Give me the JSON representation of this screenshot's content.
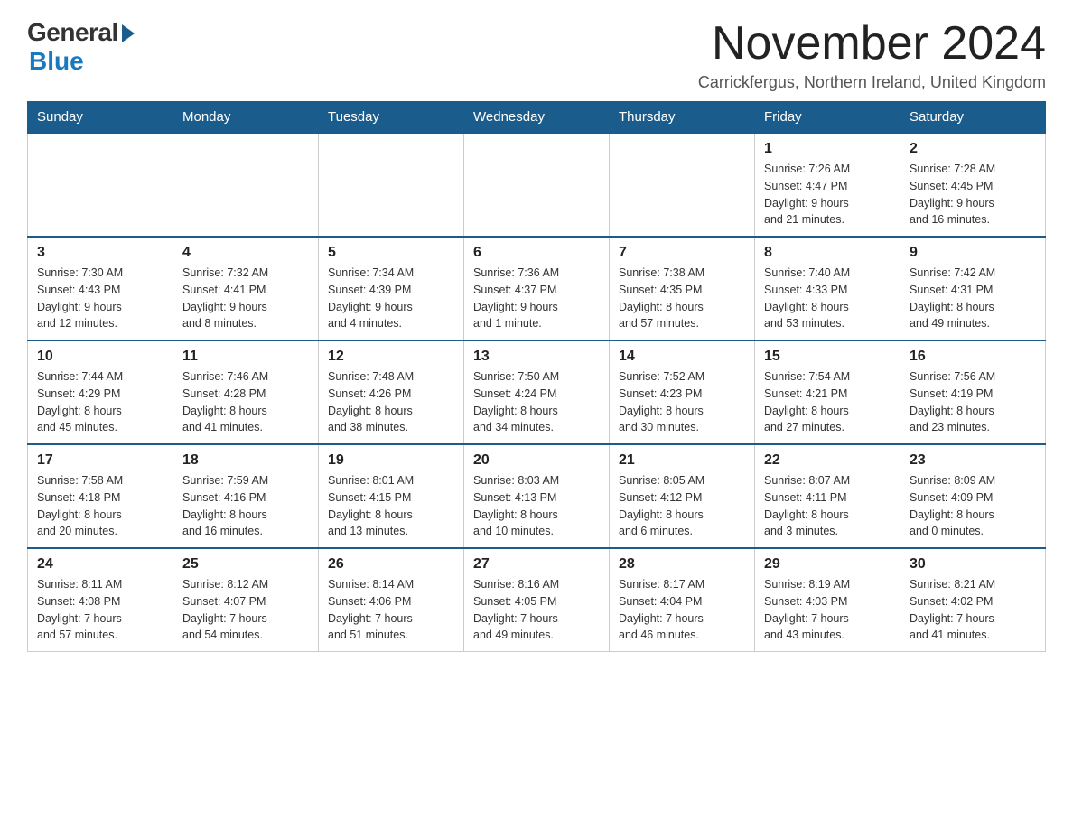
{
  "logo": {
    "general": "General",
    "blue": "Blue"
  },
  "title": "November 2024",
  "location": "Carrickfergus, Northern Ireland, United Kingdom",
  "weekdays": [
    "Sunday",
    "Monday",
    "Tuesday",
    "Wednesday",
    "Thursday",
    "Friday",
    "Saturday"
  ],
  "weeks": [
    [
      {
        "day": "",
        "info": ""
      },
      {
        "day": "",
        "info": ""
      },
      {
        "day": "",
        "info": ""
      },
      {
        "day": "",
        "info": ""
      },
      {
        "day": "",
        "info": ""
      },
      {
        "day": "1",
        "info": "Sunrise: 7:26 AM\nSunset: 4:47 PM\nDaylight: 9 hours\nand 21 minutes."
      },
      {
        "day": "2",
        "info": "Sunrise: 7:28 AM\nSunset: 4:45 PM\nDaylight: 9 hours\nand 16 minutes."
      }
    ],
    [
      {
        "day": "3",
        "info": "Sunrise: 7:30 AM\nSunset: 4:43 PM\nDaylight: 9 hours\nand 12 minutes."
      },
      {
        "day": "4",
        "info": "Sunrise: 7:32 AM\nSunset: 4:41 PM\nDaylight: 9 hours\nand 8 minutes."
      },
      {
        "day": "5",
        "info": "Sunrise: 7:34 AM\nSunset: 4:39 PM\nDaylight: 9 hours\nand 4 minutes."
      },
      {
        "day": "6",
        "info": "Sunrise: 7:36 AM\nSunset: 4:37 PM\nDaylight: 9 hours\nand 1 minute."
      },
      {
        "day": "7",
        "info": "Sunrise: 7:38 AM\nSunset: 4:35 PM\nDaylight: 8 hours\nand 57 minutes."
      },
      {
        "day": "8",
        "info": "Sunrise: 7:40 AM\nSunset: 4:33 PM\nDaylight: 8 hours\nand 53 minutes."
      },
      {
        "day": "9",
        "info": "Sunrise: 7:42 AM\nSunset: 4:31 PM\nDaylight: 8 hours\nand 49 minutes."
      }
    ],
    [
      {
        "day": "10",
        "info": "Sunrise: 7:44 AM\nSunset: 4:29 PM\nDaylight: 8 hours\nand 45 minutes."
      },
      {
        "day": "11",
        "info": "Sunrise: 7:46 AM\nSunset: 4:28 PM\nDaylight: 8 hours\nand 41 minutes."
      },
      {
        "day": "12",
        "info": "Sunrise: 7:48 AM\nSunset: 4:26 PM\nDaylight: 8 hours\nand 38 minutes."
      },
      {
        "day": "13",
        "info": "Sunrise: 7:50 AM\nSunset: 4:24 PM\nDaylight: 8 hours\nand 34 minutes."
      },
      {
        "day": "14",
        "info": "Sunrise: 7:52 AM\nSunset: 4:23 PM\nDaylight: 8 hours\nand 30 minutes."
      },
      {
        "day": "15",
        "info": "Sunrise: 7:54 AM\nSunset: 4:21 PM\nDaylight: 8 hours\nand 27 minutes."
      },
      {
        "day": "16",
        "info": "Sunrise: 7:56 AM\nSunset: 4:19 PM\nDaylight: 8 hours\nand 23 minutes."
      }
    ],
    [
      {
        "day": "17",
        "info": "Sunrise: 7:58 AM\nSunset: 4:18 PM\nDaylight: 8 hours\nand 20 minutes."
      },
      {
        "day": "18",
        "info": "Sunrise: 7:59 AM\nSunset: 4:16 PM\nDaylight: 8 hours\nand 16 minutes."
      },
      {
        "day": "19",
        "info": "Sunrise: 8:01 AM\nSunset: 4:15 PM\nDaylight: 8 hours\nand 13 minutes."
      },
      {
        "day": "20",
        "info": "Sunrise: 8:03 AM\nSunset: 4:13 PM\nDaylight: 8 hours\nand 10 minutes."
      },
      {
        "day": "21",
        "info": "Sunrise: 8:05 AM\nSunset: 4:12 PM\nDaylight: 8 hours\nand 6 minutes."
      },
      {
        "day": "22",
        "info": "Sunrise: 8:07 AM\nSunset: 4:11 PM\nDaylight: 8 hours\nand 3 minutes."
      },
      {
        "day": "23",
        "info": "Sunrise: 8:09 AM\nSunset: 4:09 PM\nDaylight: 8 hours\nand 0 minutes."
      }
    ],
    [
      {
        "day": "24",
        "info": "Sunrise: 8:11 AM\nSunset: 4:08 PM\nDaylight: 7 hours\nand 57 minutes."
      },
      {
        "day": "25",
        "info": "Sunrise: 8:12 AM\nSunset: 4:07 PM\nDaylight: 7 hours\nand 54 minutes."
      },
      {
        "day": "26",
        "info": "Sunrise: 8:14 AM\nSunset: 4:06 PM\nDaylight: 7 hours\nand 51 minutes."
      },
      {
        "day": "27",
        "info": "Sunrise: 8:16 AM\nSunset: 4:05 PM\nDaylight: 7 hours\nand 49 minutes."
      },
      {
        "day": "28",
        "info": "Sunrise: 8:17 AM\nSunset: 4:04 PM\nDaylight: 7 hours\nand 46 minutes."
      },
      {
        "day": "29",
        "info": "Sunrise: 8:19 AM\nSunset: 4:03 PM\nDaylight: 7 hours\nand 43 minutes."
      },
      {
        "day": "30",
        "info": "Sunrise: 8:21 AM\nSunset: 4:02 PM\nDaylight: 7 hours\nand 41 minutes."
      }
    ]
  ]
}
